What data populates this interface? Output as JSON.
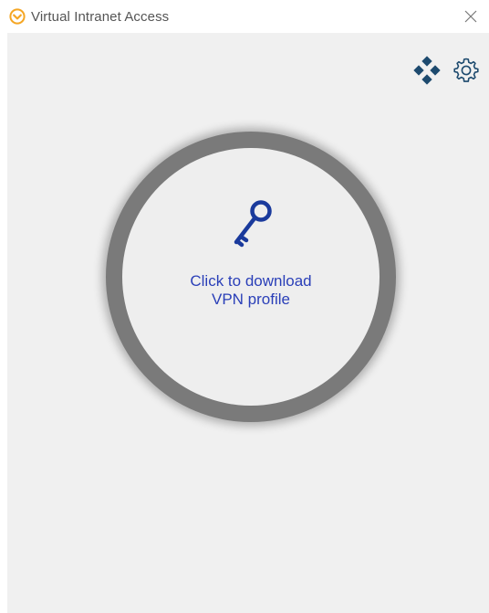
{
  "window": {
    "title": "Virtual Intranet Access"
  },
  "colors": {
    "accent_orange": "#f5a623",
    "key_blue": "#1a3a9c",
    "network_blue": "#1d4a6e",
    "text_blue": "#2a3fb8",
    "ring_gray": "#7a7a7a"
  },
  "icons": {
    "app": "app-logo-icon",
    "close": "close-icon",
    "network": "network-icon",
    "settings": "gear-icon",
    "key": "key-icon"
  },
  "main": {
    "download_line1": "Click to download",
    "download_line2": "VPN profile"
  }
}
